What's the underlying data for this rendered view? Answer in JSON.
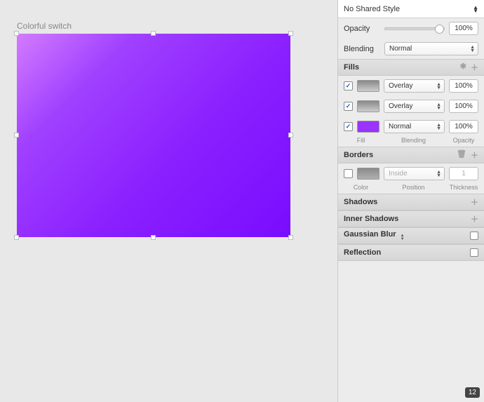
{
  "canvas": {
    "layer_name": "Colorful switch"
  },
  "inspector": {
    "shared_style": "No Shared Style",
    "opacity": {
      "label": "Opacity",
      "value": "100%"
    },
    "blending": {
      "label": "Blending",
      "value": "Normal"
    },
    "fills": {
      "header": "Fills",
      "rows": [
        {
          "checked": true,
          "swatch": "gray",
          "mode": "Overlay",
          "opacity": "100%"
        },
        {
          "checked": true,
          "swatch": "gray",
          "mode": "Overlay",
          "opacity": "100%"
        },
        {
          "checked": true,
          "swatch": "purple",
          "mode": "Normal",
          "opacity": "100%"
        }
      ],
      "col_labels": {
        "fill": "Fill",
        "blending": "Blending",
        "opacity": "Opacity"
      }
    },
    "borders": {
      "header": "Borders",
      "row": {
        "checked": false,
        "position": "Inside",
        "thickness": "1"
      },
      "col_labels": {
        "color": "Color",
        "position": "Position",
        "thickness": "Thickness"
      }
    },
    "shadows": {
      "header": "Shadows"
    },
    "inner_shadows": {
      "header": "Inner Shadows"
    },
    "gaussian_blur": {
      "header": "Gaussian Blur"
    },
    "reflection": {
      "header": "Reflection"
    }
  },
  "badge": "12"
}
